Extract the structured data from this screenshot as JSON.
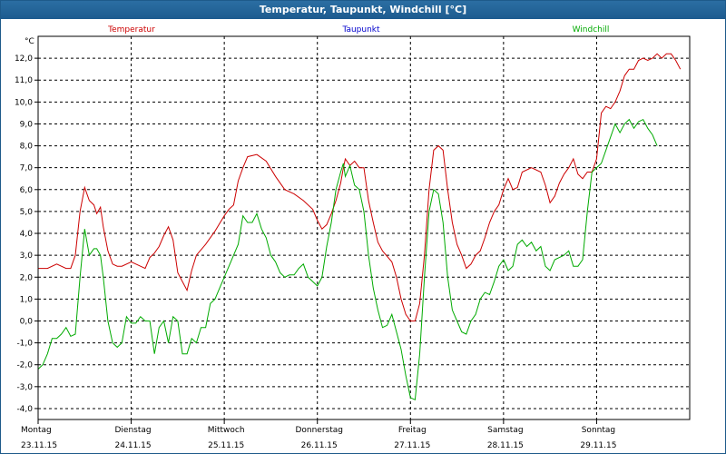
{
  "window": {
    "title": "Temperatur, Taupunkt, Windchill [°C]"
  },
  "chart_data": {
    "type": "line",
    "title": "Temperatur, Taupunkt, Windchill [°C]",
    "unit_label": "°C",
    "ylim": [
      -4.5,
      13.0
    ],
    "yticks": [
      -4.0,
      -3.0,
      -2.0,
      -1.0,
      0.0,
      1.0,
      2.0,
      3.0,
      4.0,
      5.0,
      6.0,
      7.0,
      8.0,
      9.0,
      10.0,
      11.0,
      12.0
    ],
    "ytick_labels": [
      "-4,0",
      "-3,0",
      "-2,0",
      "-1,0",
      "0,0",
      "1,0",
      "2,0",
      "3,0",
      "4,0",
      "5,0",
      "6,0",
      "7,0",
      "8,0",
      "9,0",
      "10,0",
      "11,0",
      "12,0"
    ],
    "x_unit": "days since Montag 23.11.15 00:00",
    "xlim": [
      0,
      7.0
    ],
    "day_labels": [
      {
        "x": 0,
        "weekday": "Montag",
        "date": "23.11.15"
      },
      {
        "x": 1,
        "weekday": "Dienstag",
        "date": "24.11.15"
      },
      {
        "x": 2,
        "weekday": "Mittwoch",
        "date": "25.11.15"
      },
      {
        "x": 3,
        "weekday": "Donnerstag",
        "date": "26.11.15"
      },
      {
        "x": 4,
        "weekday": "Freitag",
        "date": "27.11.15"
      },
      {
        "x": 5,
        "weekday": "Samstag",
        "date": "28.11.15"
      },
      {
        "x": 6,
        "weekday": "Sonntag",
        "date": "29.11.15"
      }
    ],
    "grid": true,
    "legend_position": "top",
    "series": [
      {
        "name": "Temperatur",
        "color": "#cc0000",
        "points": [
          [
            0,
            2.4
          ],
          [
            0.1,
            2.4
          ],
          [
            0.2,
            2.6
          ],
          [
            0.3,
            2.4
          ],
          [
            0.35,
            2.4
          ],
          [
            0.4,
            3.0
          ],
          [
            0.45,
            5.0
          ],
          [
            0.5,
            6.1
          ],
          [
            0.55,
            5.5
          ],
          [
            0.6,
            5.3
          ],
          [
            0.63,
            4.9
          ],
          [
            0.67,
            5.2
          ],
          [
            0.7,
            4.3
          ],
          [
            0.75,
            3.2
          ],
          [
            0.8,
            2.6
          ],
          [
            0.85,
            2.5
          ],
          [
            0.9,
            2.5
          ],
          [
            1.0,
            2.7
          ],
          [
            1.1,
            2.5
          ],
          [
            1.15,
            2.4
          ],
          [
            1.2,
            2.9
          ],
          [
            1.25,
            3.1
          ],
          [
            1.3,
            3.4
          ],
          [
            1.35,
            3.9
          ],
          [
            1.4,
            4.3
          ],
          [
            1.45,
            3.7
          ],
          [
            1.5,
            2.2
          ],
          [
            1.55,
            1.8
          ],
          [
            1.6,
            1.4
          ],
          [
            1.65,
            2.3
          ],
          [
            1.7,
            3.0
          ],
          [
            1.8,
            3.5
          ],
          [
            1.9,
            4.1
          ],
          [
            2.0,
            4.8
          ],
          [
            2.05,
            5.1
          ],
          [
            2.1,
            5.3
          ],
          [
            2.15,
            6.4
          ],
          [
            2.2,
            7.0
          ],
          [
            2.25,
            7.5
          ],
          [
            2.35,
            7.6
          ],
          [
            2.45,
            7.3
          ],
          [
            2.55,
            6.6
          ],
          [
            2.65,
            6.0
          ],
          [
            2.75,
            5.8
          ],
          [
            2.85,
            5.5
          ],
          [
            2.95,
            5.1
          ],
          [
            3.0,
            4.6
          ],
          [
            3.05,
            4.2
          ],
          [
            3.1,
            4.4
          ],
          [
            3.15,
            4.9
          ],
          [
            3.2,
            5.5
          ],
          [
            3.25,
            6.3
          ],
          [
            3.28,
            7.0
          ],
          [
            3.3,
            7.4
          ],
          [
            3.35,
            7.1
          ],
          [
            3.4,
            7.3
          ],
          [
            3.45,
            7.0
          ],
          [
            3.5,
            7.0
          ],
          [
            3.55,
            5.5
          ],
          [
            3.6,
            4.5
          ],
          [
            3.65,
            3.6
          ],
          [
            3.7,
            3.2
          ],
          [
            3.8,
            2.7
          ],
          [
            3.85,
            2.0
          ],
          [
            3.9,
            1.0
          ],
          [
            3.95,
            0.3
          ],
          [
            4.0,
            0.0
          ],
          [
            4.05,
            0.0
          ],
          [
            4.1,
            0.8
          ],
          [
            4.15,
            3.0
          ],
          [
            4.2,
            6.0
          ],
          [
            4.25,
            7.8
          ],
          [
            4.3,
            8.0
          ],
          [
            4.35,
            7.8
          ],
          [
            4.4,
            6.0
          ],
          [
            4.45,
            4.5
          ],
          [
            4.5,
            3.5
          ],
          [
            4.55,
            3.0
          ],
          [
            4.6,
            2.4
          ],
          [
            4.65,
            2.6
          ],
          [
            4.7,
            3.0
          ],
          [
            4.75,
            3.2
          ],
          [
            4.8,
            3.8
          ],
          [
            4.85,
            4.5
          ],
          [
            4.9,
            5.0
          ],
          [
            4.95,
            5.3
          ],
          [
            5.0,
            6.0
          ],
          [
            5.05,
            6.5
          ],
          [
            5.1,
            6.0
          ],
          [
            5.15,
            6.1
          ],
          [
            5.2,
            6.8
          ],
          [
            5.3,
            7.0
          ],
          [
            5.4,
            6.8
          ],
          [
            5.45,
            6.2
          ],
          [
            5.5,
            5.4
          ],
          [
            5.55,
            5.7
          ],
          [
            5.6,
            6.3
          ],
          [
            5.65,
            6.7
          ],
          [
            5.7,
            7.0
          ],
          [
            5.75,
            7.4
          ],
          [
            5.8,
            6.7
          ],
          [
            5.85,
            6.5
          ],
          [
            5.9,
            6.8
          ],
          [
            5.95,
            6.8
          ],
          [
            6.0,
            7.4
          ],
          [
            6.05,
            9.5
          ],
          [
            6.1,
            9.8
          ],
          [
            6.15,
            9.7
          ],
          [
            6.2,
            10.0
          ],
          [
            6.25,
            10.5
          ],
          [
            6.3,
            11.2
          ],
          [
            6.35,
            11.5
          ],
          [
            6.4,
            11.5
          ],
          [
            6.45,
            11.9
          ],
          [
            6.5,
            12.0
          ],
          [
            6.55,
            11.9
          ],
          [
            6.6,
            12.0
          ],
          [
            6.65,
            12.2
          ],
          [
            6.7,
            12.0
          ],
          [
            6.75,
            12.2
          ],
          [
            6.8,
            12.2
          ],
          [
            6.85,
            11.9
          ],
          [
            6.9,
            11.5
          ]
        ]
      },
      {
        "name": "Taupunkt",
        "color": "#0000cc",
        "points": []
      },
      {
        "name": "Windchill",
        "color": "#00aa00",
        "points": [
          [
            0,
            -2.2
          ],
          [
            0.05,
            -2.0
          ],
          [
            0.1,
            -1.5
          ],
          [
            0.15,
            -0.8
          ],
          [
            0.2,
            -0.8
          ],
          [
            0.25,
            -0.6
          ],
          [
            0.3,
            -0.3
          ],
          [
            0.35,
            -0.7
          ],
          [
            0.4,
            -0.6
          ],
          [
            0.45,
            2.0
          ],
          [
            0.5,
            4.2
          ],
          [
            0.55,
            3.0
          ],
          [
            0.6,
            3.3
          ],
          [
            0.63,
            3.3
          ],
          [
            0.67,
            3.0
          ],
          [
            0.7,
            2.0
          ],
          [
            0.75,
            0.0
          ],
          [
            0.8,
            -1.0
          ],
          [
            0.85,
            -1.2
          ],
          [
            0.9,
            -1.0
          ],
          [
            0.95,
            0.2
          ],
          [
            1.0,
            -0.1
          ],
          [
            1.05,
            -0.1
          ],
          [
            1.1,
            0.2
          ],
          [
            1.15,
            0.0
          ],
          [
            1.2,
            0.0
          ],
          [
            1.25,
            -1.5
          ],
          [
            1.3,
            -0.3
          ],
          [
            1.35,
            0.0
          ],
          [
            1.4,
            -1.0
          ],
          [
            1.45,
            0.2
          ],
          [
            1.5,
            0.0
          ],
          [
            1.55,
            -1.5
          ],
          [
            1.6,
            -1.5
          ],
          [
            1.65,
            -0.8
          ],
          [
            1.7,
            -1.0
          ],
          [
            1.75,
            -0.3
          ],
          [
            1.8,
            -0.3
          ],
          [
            1.85,
            0.8
          ],
          [
            1.9,
            1.0
          ],
          [
            1.95,
            1.5
          ],
          [
            2.0,
            2.0
          ],
          [
            2.05,
            2.5
          ],
          [
            2.1,
            3.0
          ],
          [
            2.15,
            3.5
          ],
          [
            2.2,
            4.8
          ],
          [
            2.25,
            4.5
          ],
          [
            2.3,
            4.5
          ],
          [
            2.35,
            4.9
          ],
          [
            2.4,
            4.2
          ],
          [
            2.45,
            3.8
          ],
          [
            2.5,
            3.0
          ],
          [
            2.55,
            2.7
          ],
          [
            2.6,
            2.2
          ],
          [
            2.65,
            2.0
          ],
          [
            2.7,
            2.1
          ],
          [
            2.75,
            2.1
          ],
          [
            2.8,
            2.4
          ],
          [
            2.85,
            2.6
          ],
          [
            2.9,
            2.0
          ],
          [
            2.95,
            1.8
          ],
          [
            3.0,
            1.6
          ],
          [
            3.05,
            2.0
          ],
          [
            3.1,
            3.4
          ],
          [
            3.15,
            4.5
          ],
          [
            3.2,
            6.0
          ],
          [
            3.25,
            6.8
          ],
          [
            3.28,
            7.2
          ],
          [
            3.3,
            6.6
          ],
          [
            3.35,
            7.1
          ],
          [
            3.4,
            6.2
          ],
          [
            3.45,
            6.0
          ],
          [
            3.5,
            5.0
          ],
          [
            3.55,
            3.0
          ],
          [
            3.6,
            1.5
          ],
          [
            3.65,
            0.5
          ],
          [
            3.7,
            -0.3
          ],
          [
            3.75,
            -0.2
          ],
          [
            3.8,
            0.3
          ],
          [
            3.85,
            -0.5
          ],
          [
            3.9,
            -1.3
          ],
          [
            3.95,
            -2.5
          ],
          [
            4.0,
            -3.5
          ],
          [
            4.05,
            -3.6
          ],
          [
            4.1,
            -1.5
          ],
          [
            4.15,
            2.0
          ],
          [
            4.2,
            5.0
          ],
          [
            4.25,
            6.0
          ],
          [
            4.3,
            5.8
          ],
          [
            4.35,
            4.5
          ],
          [
            4.4,
            2.0
          ],
          [
            4.45,
            0.5
          ],
          [
            4.5,
            0.0
          ],
          [
            4.55,
            -0.5
          ],
          [
            4.6,
            -0.6
          ],
          [
            4.65,
            0.0
          ],
          [
            4.7,
            0.3
          ],
          [
            4.75,
            1.0
          ],
          [
            4.8,
            1.3
          ],
          [
            4.85,
            1.2
          ],
          [
            4.9,
            1.8
          ],
          [
            4.95,
            2.5
          ],
          [
            5.0,
            2.8
          ],
          [
            5.05,
            2.3
          ],
          [
            5.1,
            2.5
          ],
          [
            5.15,
            3.5
          ],
          [
            5.2,
            3.7
          ],
          [
            5.25,
            3.4
          ],
          [
            5.3,
            3.6
          ],
          [
            5.35,
            3.2
          ],
          [
            5.4,
            3.4
          ],
          [
            5.45,
            2.5
          ],
          [
            5.5,
            2.3
          ],
          [
            5.55,
            2.8
          ],
          [
            5.6,
            2.9
          ],
          [
            5.65,
            3.0
          ],
          [
            5.7,
            3.2
          ],
          [
            5.75,
            2.5
          ],
          [
            5.8,
            2.5
          ],
          [
            5.85,
            2.8
          ],
          [
            5.9,
            5.0
          ],
          [
            5.95,
            6.8
          ],
          [
            6.0,
            7.0
          ],
          [
            6.05,
            7.2
          ],
          [
            6.1,
            7.8
          ],
          [
            6.15,
            8.4
          ],
          [
            6.2,
            9.0
          ],
          [
            6.25,
            8.6
          ],
          [
            6.3,
            9.0
          ],
          [
            6.35,
            9.2
          ],
          [
            6.4,
            8.8
          ],
          [
            6.45,
            9.1
          ],
          [
            6.5,
            9.2
          ],
          [
            6.55,
            8.8
          ],
          [
            6.6,
            8.5
          ],
          [
            6.65,
            8.0
          ]
        ]
      }
    ]
  }
}
